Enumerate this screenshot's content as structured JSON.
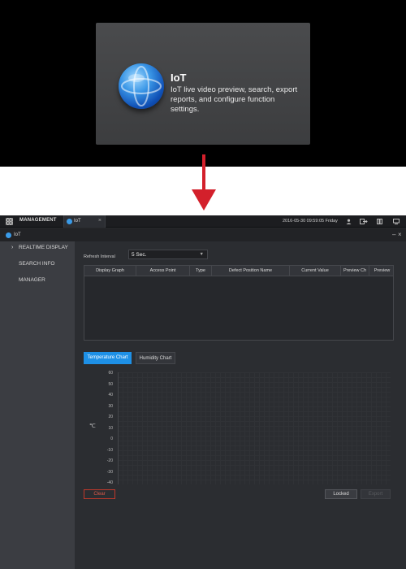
{
  "tile": {
    "title": "IoT",
    "description": "IoT live video preview, search, export reports, and configure function settings."
  },
  "titlebar": {
    "management_label": "MANAGEMENT",
    "tab_label": "IoT",
    "tab_close": "×",
    "datetime": "2016-05-30 09:59:05 Friday"
  },
  "window": {
    "title": "IoT",
    "minimize": "–",
    "close": "×"
  },
  "sidebar": {
    "items": [
      {
        "label": "REALTIME DISPLAY",
        "active": true
      },
      {
        "label": "SEARCH INFO",
        "active": false
      },
      {
        "label": "MANAGER",
        "active": false
      }
    ]
  },
  "main": {
    "refresh_label": "Refresh Interval",
    "refresh_value": "5 Sec.",
    "table_headers": [
      "Display Graph",
      "Access Point",
      "Type",
      "Defect Position Name",
      "Current Value",
      "Preview Ch",
      "Preview"
    ],
    "chart_tabs": [
      "Temperature Chart",
      "Humidity Chart"
    ],
    "y_ticks": [
      "60",
      "50",
      "40",
      "30",
      "20",
      "10",
      "0",
      "-10",
      "-20",
      "-30",
      "-40"
    ],
    "buttons": {
      "clear": "Clear",
      "locked": "Locked",
      "export": "Export"
    }
  },
  "colors": {
    "accent": "#1e90e6",
    "danger": "#e05a4a",
    "arrow": "#d3202b"
  }
}
